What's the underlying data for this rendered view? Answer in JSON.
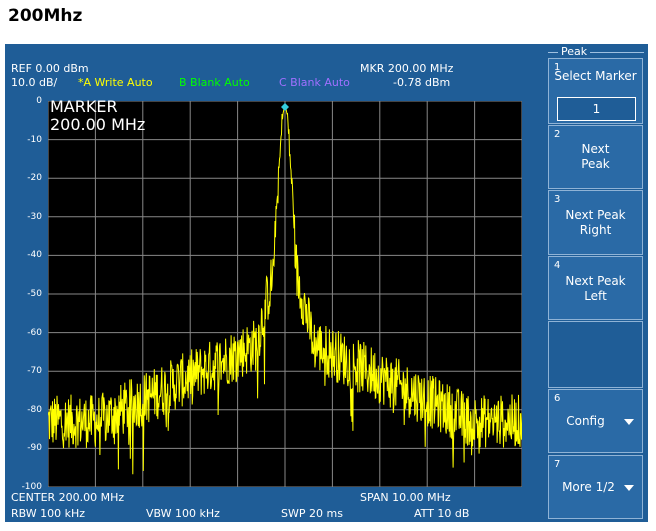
{
  "page": {
    "title": "200Mhz"
  },
  "header": {
    "ref": "REF  0.00 dBm",
    "scale": "10.0 dB/",
    "trace_a": "*A Write Auto",
    "trace_b": "B Blank Auto",
    "trace_c": "C Blank Auto",
    "mkr": "MKR 200.00 MHz",
    "mkr_level": "-0.78 dBm"
  },
  "marker_readout": {
    "title": "MARKER",
    "freq": "200.00 MHz"
  },
  "y_axis": {
    "labels": [
      "0",
      "-10",
      "-20",
      "-30",
      "-40",
      "-50",
      "-60",
      "-70",
      "-80",
      "-90",
      "-100"
    ]
  },
  "footer": {
    "center": "CENTER 200.00 MHz",
    "span": "SPAN  10.00 MHz",
    "rbw": "RBW  100 kHz",
    "vbw": "VBW  100 kHz",
    "swp": "SWP  20 ms",
    "att": "ATT  10 dB"
  },
  "softkeys": {
    "title": "Peak",
    "keys": [
      {
        "num": "1",
        "label": "Select Marker",
        "value": "1"
      },
      {
        "num": "2",
        "label1": "Next",
        "label2": "Peak"
      },
      {
        "num": "3",
        "label1": "Next Peak",
        "label2": "Right"
      },
      {
        "num": "4",
        "label1": "Next Peak",
        "label2": "Left"
      },
      {
        "num": "6",
        "label": "Config"
      },
      {
        "num": "7",
        "label": "More 1/2"
      }
    ]
  },
  "colors": {
    "trace_a": "#ffff00",
    "trace_b": "#00ff00",
    "trace_c": "#a070ff",
    "marker": "#33ccdd",
    "frame": "#1f5d97"
  },
  "chart_data": {
    "type": "line",
    "x_center_mhz": 200.0,
    "x_span_mhz": 10.0,
    "xlim": [
      195.0,
      205.0
    ],
    "ylim": [
      -100,
      0
    ],
    "grid": true,
    "series": [
      {
        "name": "*A Write Auto",
        "peak_x": 200.0,
        "peak_y": -0.78,
        "noise_floor_approx": -83
      }
    ],
    "marker": {
      "x": 200.0,
      "y": -0.78
    }
  }
}
